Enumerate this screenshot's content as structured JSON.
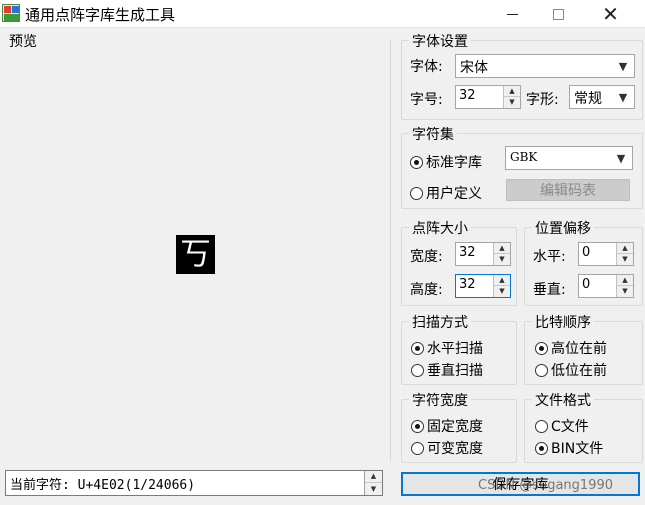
{
  "window": {
    "title": "通用点阵字库生成工具",
    "min_icon": "minimize-icon",
    "max_icon": "maximize-icon",
    "close_glyph": "✕"
  },
  "preview": {
    "label": "预览",
    "glyph": "丂"
  },
  "status": {
    "text": "当前字符: U+4E02(1/24066)"
  },
  "font_settings": {
    "title": "字体设置",
    "font_label": "字体:",
    "font_value": "宋体",
    "size_label": "字号:",
    "size_value": "32",
    "style_label": "字形:",
    "style_value": "常规"
  },
  "charset": {
    "title": "字符集",
    "standard_label": "标准字库",
    "standard_value": "GBK",
    "user_label": "用户定义",
    "edit_button": "编辑码表",
    "selected": "standard"
  },
  "dot_size": {
    "title": "点阵大小",
    "width_label": "宽度:",
    "width_value": "32",
    "height_label": "高度:",
    "height_value": "32"
  },
  "offset": {
    "title": "位置偏移",
    "h_label": "水平:",
    "h_value": "0",
    "v_label": "垂直:",
    "v_value": "0"
  },
  "scan": {
    "title": "扫描方式",
    "opt1": "水平扫描",
    "opt2": "垂直扫描",
    "selected": "opt1"
  },
  "bit_order": {
    "title": "比特顺序",
    "opt1": "高位在前",
    "opt2": "低位在前",
    "selected": "opt1"
  },
  "char_width": {
    "title": "字符宽度",
    "opt1": "固定宽度",
    "opt2": "可变宽度",
    "selected": "opt1"
  },
  "file_format": {
    "title": "文件格式",
    "opt1": "C文件",
    "opt2": "BIN文件",
    "selected": "opt2"
  },
  "save_button": "保存字库",
  "watermark": "CSDN @sugang1990",
  "icons": {
    "caret": "▼",
    "spin_up": "▲",
    "spin_down": "▼"
  }
}
